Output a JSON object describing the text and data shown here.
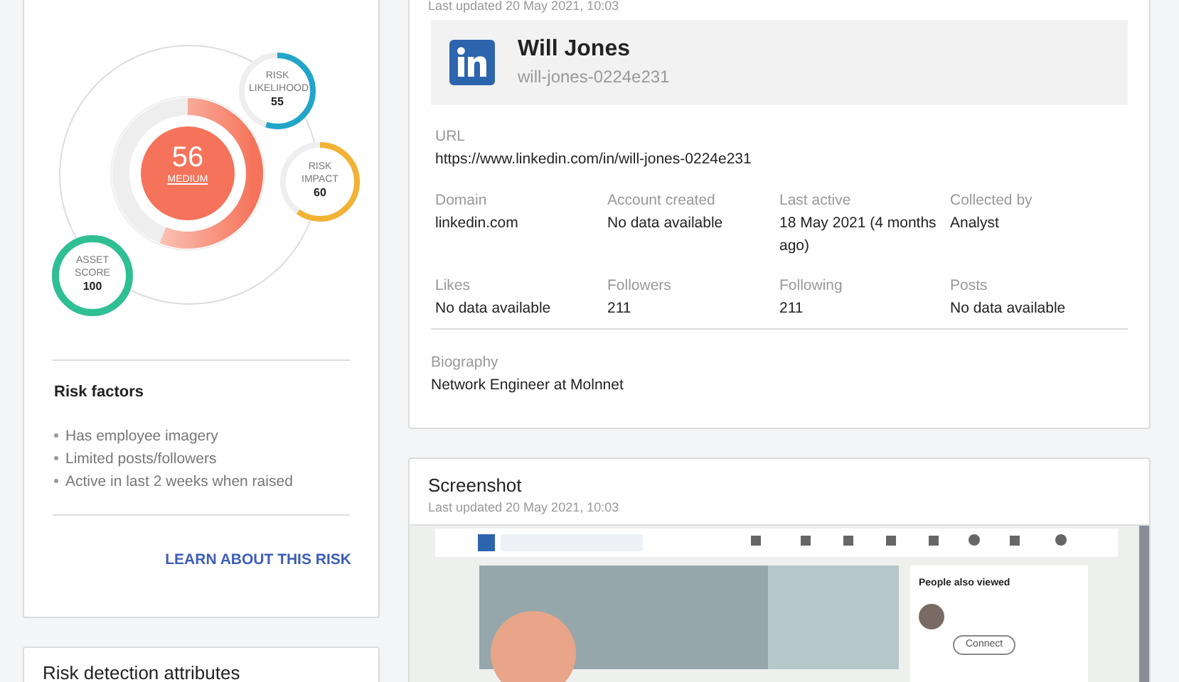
{
  "risk_card": {
    "gauge": {
      "score": "56",
      "rating": "MEDIUM",
      "level": 0.56
    },
    "gauges": [
      {
        "kind": "likelihood",
        "label": "RISK LIKELIHOOD",
        "value": "55",
        "level": 0.55,
        "color": "#22a5c9"
      },
      {
        "kind": "impact",
        "label": "RISK IMPACT",
        "value": "60",
        "level": 0.6,
        "color": "#f2b233"
      },
      {
        "kind": "asset",
        "label": "ASSET SCORE",
        "value": "100",
        "level": 1,
        "color": "#2fbf94"
      }
    ],
    "factors_title": "Risk factors",
    "factors": [
      "Has employee imagery",
      "Limited posts/followers",
      "Active in last 2 weeks when raised"
    ],
    "link": "LEARN ABOUT THIS RISK"
  },
  "attributes_card": {
    "title": "Risk detection attributes"
  },
  "profile_card": {
    "updated": "Last updated 20 May 2021, 10:03",
    "name": "Will Jones",
    "handle": "will-jones-0224e231",
    "url_label": "URL",
    "url": "https://www.linkedin.com/in/will-jones-0224e231",
    "fields": [
      {
        "label": "Domain",
        "value": "linkedin.com"
      },
      {
        "label": "Account created",
        "value": "No data available"
      },
      {
        "label": "Last active",
        "value": "18 May 2021 (4 months ago)"
      },
      {
        "label": "Collected by",
        "value": "Analyst"
      },
      {
        "label": "Likes",
        "value": "No data available"
      },
      {
        "label": "Followers",
        "value": "211"
      },
      {
        "label": "Following",
        "value": "211"
      },
      {
        "label": "Posts",
        "value": "No data available"
      }
    ],
    "bio_label": "Biography",
    "bio": "Network Engineer at Molnnet"
  },
  "screenshot_card": {
    "title": "Screenshot",
    "updated": "Last updated 20 May 2021, 10:03",
    "side_title": "People also viewed",
    "connect": "Connect"
  }
}
